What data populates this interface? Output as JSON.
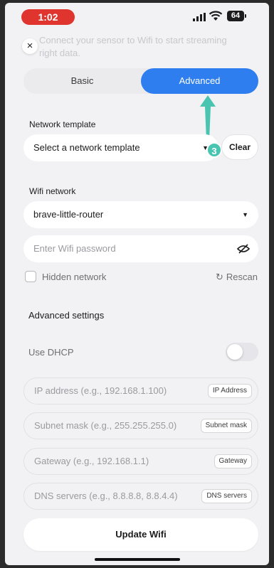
{
  "status_bar": {
    "time": "1:02",
    "battery": "64"
  },
  "intro_text": "Connect your sensor to Wifi to start streaming right data.",
  "tabs": [
    {
      "label": "Basic",
      "active": false
    },
    {
      "label": "Advanced",
      "active": true
    }
  ],
  "network_template": {
    "label": "Network template",
    "value": "Select a network template",
    "clear_label": "Clear"
  },
  "wifi": {
    "label": "Wifi network",
    "selected_network": "brave-little-router",
    "password_placeholder": "Enter Wifi password",
    "hidden_label": "Hidden network",
    "rescan_label": "Rescan"
  },
  "advanced": {
    "title": "Advanced settings",
    "dhcp_label": "Use DHCP",
    "dhcp_on": false,
    "fields": [
      {
        "placeholder": "IP address (e.g., 192.168.1.100)",
        "tag": "IP Address"
      },
      {
        "placeholder": "Subnet mask (e.g., 255.255.255.0)",
        "tag": "Subnet mask"
      },
      {
        "placeholder": "Gateway (e.g., 192.168.1.1)",
        "tag": "Gateway"
      },
      {
        "placeholder": "DNS servers (e.g., 8.8.8.8, 8.8.4.4)",
        "tag": "DNS servers"
      }
    ]
  },
  "update_label": "Update Wifi",
  "callout": {
    "number": "3"
  },
  "colors": {
    "accent": "#2f7ef0",
    "callout": "#48c4b0",
    "time_pill": "#e0342e"
  }
}
